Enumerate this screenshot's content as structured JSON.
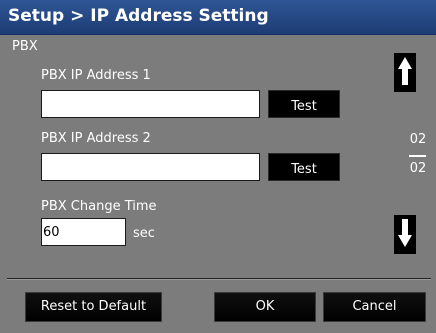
{
  "window": {
    "title": "Setup > IP Address Setting"
  },
  "section": {
    "label": "PBX"
  },
  "pbx_ip_1": {
    "label": "PBX IP Address 1",
    "value": "",
    "test_label": "Test"
  },
  "pbx_ip_2": {
    "label": "PBX IP Address 2",
    "value": "",
    "test_label": "Test"
  },
  "change_time": {
    "label": "PBX Change Time",
    "value": "60",
    "unit": "sec"
  },
  "pager": {
    "current": "02",
    "total": "02",
    "up_icon": "arrow-up-icon",
    "down_icon": "arrow-down-icon"
  },
  "footer": {
    "reset_label": "Reset to Default",
    "ok_label": "OK",
    "cancel_label": "Cancel"
  },
  "colors": {
    "titlebar": "#1f3f7a",
    "background": "#7c7c7c",
    "button": "#000000",
    "text": "#ffffff"
  }
}
